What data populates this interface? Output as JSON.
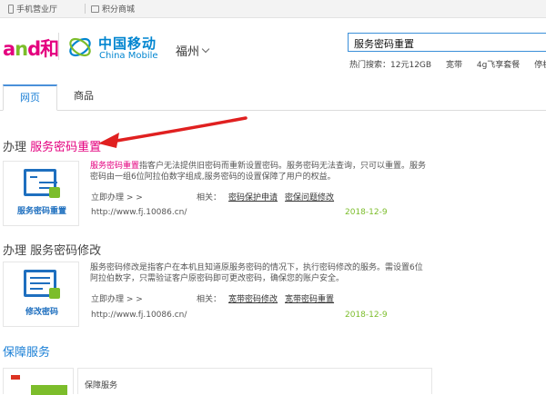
{
  "topbar": {
    "links": [
      {
        "label": "手机营业厅",
        "icon": "phone-icon"
      },
      {
        "label": "积分商城",
        "icon": "cart-icon"
      }
    ]
  },
  "header": {
    "and_logo_prefix": "a",
    "and_logo_mid": "n",
    "and_logo_suffix": "d和",
    "brand_cn": "中国移动",
    "brand_en": "China Mobile",
    "city": "福州"
  },
  "search": {
    "value": "服务密码重置",
    "hot_label": "热门搜索：",
    "hot_items": [
      "12元12GB",
      "宽带",
      "4g飞享套餐",
      "停机"
    ]
  },
  "tabs": [
    {
      "label": "网页",
      "active": true
    },
    {
      "label": "商品",
      "active": false
    }
  ],
  "results": [
    {
      "prefix": "办理 ",
      "title": "服务密码重置",
      "thumb_caption": "服务密码重置",
      "desc_highlight": "服务密码重置",
      "desc": "指客户无法提供旧密码而重新设置密码。服务密码无法查询，只可以重置。服务密码由一组6位阿拉伯数字组成,服务密码的设置保障了用户的权益。",
      "action": "立即办理 > >",
      "related_label": "相关：",
      "related": [
        "密码保护申请",
        "密保问题修改"
      ],
      "url": "http://www.fj.10086.cn/",
      "date": "2018-12-9"
    },
    {
      "prefix": "办理 ",
      "title": "服务密码修改",
      "thumb_caption": "修改密码",
      "desc_highlight": "",
      "desc": "服务密码修改是指客户在本机且知道原服务密码的情况下，执行密码修改的服务。需设置6位阿拉伯数字，只需验证客户原密码即可更改密码，确保您的账户安全。",
      "action": "立即办理 > >",
      "related_label": "相关：",
      "related": [
        "宽带密码修改",
        "宽带密码重置"
      ],
      "url": "http://www.fj.10086.cn/",
      "date": "2018-12-9"
    }
  ],
  "section3": {
    "title": "保障服务",
    "item": "保障服务"
  },
  "colors": {
    "accent_blue": "#1a7fd6",
    "highlight_pink": "#e4007f",
    "date_green": "#7cbd2b",
    "arrow_red": "#e02020"
  }
}
